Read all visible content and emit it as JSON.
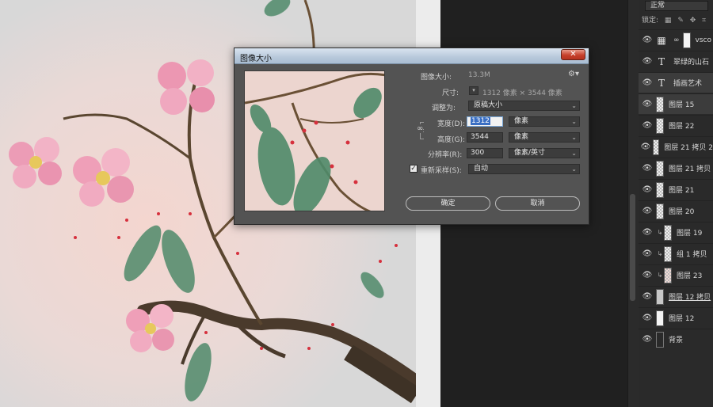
{
  "layers_panel": {
    "blend_mode": "正常",
    "lock_label": "锁定:",
    "layers": [
      {
        "name": "vsco",
        "type": "adjustment",
        "visible": true
      },
      {
        "name": "翠绿的山石",
        "type": "text",
        "visible": true
      },
      {
        "name": "插画艺术",
        "type": "text",
        "visible": true
      },
      {
        "name": "图层 15",
        "type": "pixel",
        "visible": true
      },
      {
        "name": "图层 22",
        "type": "pixel",
        "visible": true
      },
      {
        "name": "图层 21 拷贝 2",
        "type": "pixel",
        "visible": true
      },
      {
        "name": "图层 21 拷贝",
        "type": "pixel",
        "visible": true
      },
      {
        "name": "图层 21",
        "type": "pixel",
        "visible": true
      },
      {
        "name": "图层 20",
        "type": "pixel",
        "visible": true
      },
      {
        "name": "图层 19",
        "type": "pixel",
        "visible": true,
        "clipped": true
      },
      {
        "name": "组 1 拷贝",
        "type": "pixel",
        "visible": true,
        "clipped": true
      },
      {
        "name": "图层 23",
        "type": "pixel",
        "visible": true,
        "clipped": true
      },
      {
        "name": "图层 12 拷贝",
        "type": "pixel",
        "visible": true
      },
      {
        "name": "图层 12",
        "type": "pixel",
        "visible": true
      },
      {
        "name": "背景",
        "type": "background",
        "visible": true
      }
    ]
  },
  "dialog": {
    "title": "图像大小",
    "close_glyph": "✕",
    "image_size_label": "图像大小:",
    "image_size_value": "13.3M",
    "dimensions_label": "尺寸:",
    "dimensions_value": "1312 像素  ×  3544 像素",
    "fit_to_label": "调整为:",
    "fit_to_value": "原稿大小",
    "width_label": "宽度(D):",
    "width_value": "1312",
    "width_unit": "像素",
    "height_label": "高度(G):",
    "height_value": "3544",
    "height_unit": "像素",
    "resolution_label": "分辨率(R):",
    "resolution_value": "300",
    "resolution_unit": "像素/英寸",
    "resample_label": "重新采样(S):",
    "resample_value": "自动",
    "resample_checked": true,
    "ok_label": "确定",
    "cancel_label": "取消"
  }
}
